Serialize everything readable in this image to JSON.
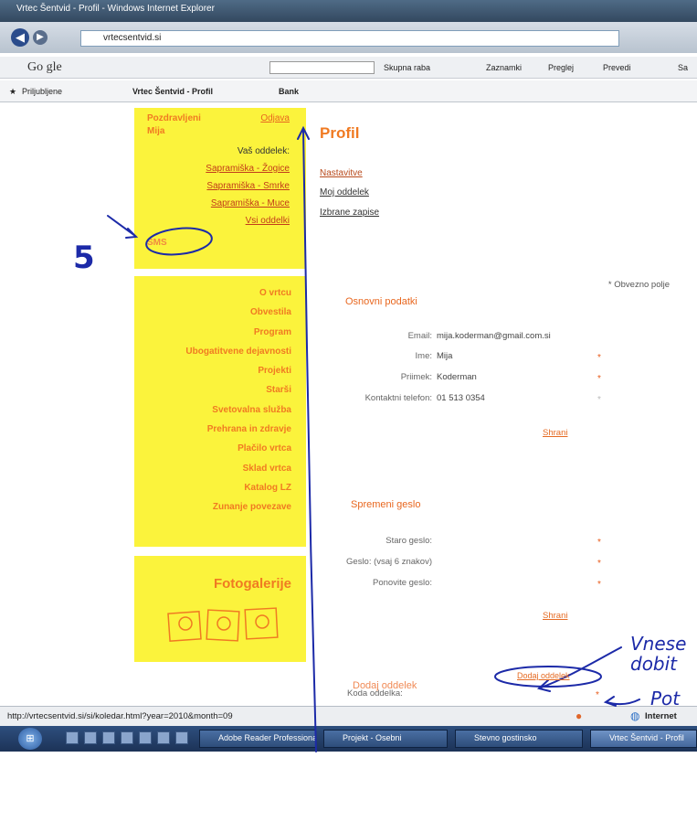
{
  "window": {
    "title": "Vrtec Šentvid - Profil - Windows Internet Explorer"
  },
  "address": {
    "url": "vrtecsentvid.si"
  },
  "googlebar": {
    "brand": "Go gle",
    "tools": [
      "Skupna raba",
      "Zaznamki",
      "Preglej",
      "Prevedi",
      "Sa"
    ]
  },
  "favorites": {
    "label": "Priljubljene",
    "tab": "Vrtec Šentvid - Profil",
    "bank": "Bank"
  },
  "sidebar": {
    "greeting": "Pozdravljeni",
    "logout": "Odjava",
    "user": "Mija",
    "groups_title": "Vaš oddelek:",
    "groups": [
      "Sapramiška - Žogice",
      "Sapramiška - Smrke",
      "Sapramiška - Muce"
    ],
    "all_groups": "Vsi oddelki",
    "sms": "SMS",
    "menu": [
      "O vrtcu",
      "Obvestila",
      "Program",
      "Ubogatitvene dejavnosti",
      "Projekti",
      "Starši",
      "Svetovalna služba",
      "Prehrana in zdravje",
      "Plačilo vrtca",
      "Sklad vrtca",
      "Katalog LZ",
      "Zunanje povezave"
    ],
    "gallery": "Fotogalerije"
  },
  "main": {
    "heading": "Profil",
    "links": [
      "Nastavitve",
      "Moj oddelek",
      "Izbrane zapise"
    ],
    "required_note": "* Obvezno polje",
    "basic_title": "Osnovni podatki",
    "fields": [
      {
        "label": "Email:",
        "value": "mija.koderman@gmail.com.si",
        "req": ""
      },
      {
        "label": "Ime:",
        "value": "Mija",
        "req": "*"
      },
      {
        "label": "Priimek:",
        "value": "Koderman",
        "req": "*"
      },
      {
        "label": "Kontaktni telefon:",
        "value": "01 513 0354",
        "req": "*"
      }
    ],
    "save1": "Shrani",
    "password_title": "Spremeni geslo",
    "pw_fields": [
      {
        "label": "Staro geslo:",
        "req": "*"
      },
      {
        "label": "Geslo: (vsaj 6 znakov)",
        "req": "*"
      },
      {
        "label": "Ponovite geslo:",
        "req": "*"
      }
    ],
    "save2": "Shrani",
    "add_title": "Dodaj oddelek",
    "code_label": "Koda oddelka:",
    "code_req": "*",
    "add_button": "Dodaj oddelek"
  },
  "statusbar": {
    "url": "http://vrtecsentvid.si/si/koledar.html?year=2010&month=09",
    "zone": "Internet"
  },
  "taskbar": {
    "items": [
      "Adobe Reader Professional",
      "Projekt - Osebni",
      "Stevno gostinsko",
      "Vrtec Šentvid - Profil"
    ]
  },
  "annotations": {
    "step": "5",
    "note1": "Vnese",
    "note2": "dobit",
    "note3": "Pot"
  },
  "colors": {
    "sidebar_bg": "#fbf33c",
    "accent": "#f07a22",
    "ink": "#1c2aa8"
  }
}
